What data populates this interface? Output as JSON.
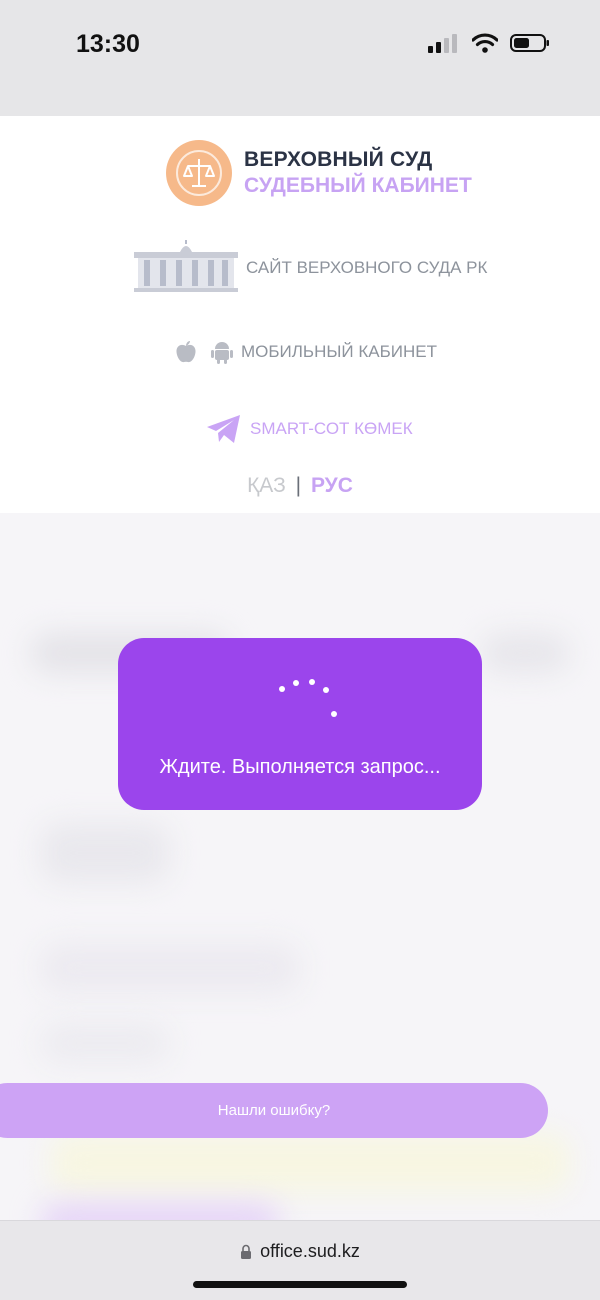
{
  "status_bar": {
    "time": "13:30",
    "icons": [
      "cellular-signal-icon",
      "wifi-icon",
      "battery-icon"
    ]
  },
  "header": {
    "brand_title": "ВЕРХОВНЫЙ СУД",
    "brand_subtitle": "СУДЕБНЫЙ КАБИНЕТ",
    "links": {
      "site": "САЙТ ВЕРХОВНОГО СУДА РК",
      "mobile": "МОБИЛЬНЫЙ КАБИНЕТ",
      "smart": "SMART-СОТ КӨМЕК"
    },
    "lang": {
      "kaz": "ҚАЗ",
      "separator": "|",
      "rus": "РУС"
    }
  },
  "modal": {
    "message": "Ждите. Выполняется запрос..."
  },
  "report_button": {
    "label": "Нашли ошибку?"
  },
  "browser": {
    "url": "office.sud.kz"
  },
  "colors": {
    "accent": "#9b45ec",
    "accent_light": "#cda3f5",
    "logo": "#f6b98a"
  }
}
